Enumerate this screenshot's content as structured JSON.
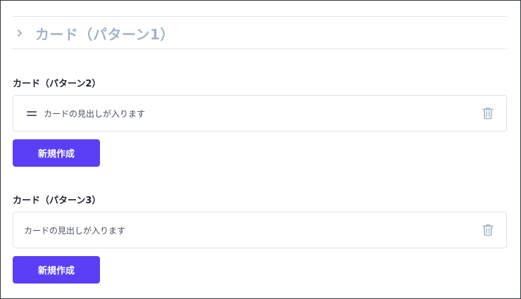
{
  "section1": {
    "title": "カード（パターン1）",
    "icon": "chevron-right-icon"
  },
  "group2": {
    "label": "カード（パターン2）",
    "card": {
      "text": "カードの見出しが入ります",
      "drag_icon": "drag-handle-icon",
      "delete_icon": "trash-icon"
    },
    "button": "新規作成"
  },
  "group3": {
    "label": "カード（パターン3）",
    "card": {
      "text": "カードの見出しが入ります",
      "delete_icon": "trash-icon"
    },
    "button": "新規作成"
  },
  "colors": {
    "accent": "#5a3ff6",
    "muted_title": "#a3b4c8",
    "border": "#dde3ec"
  }
}
